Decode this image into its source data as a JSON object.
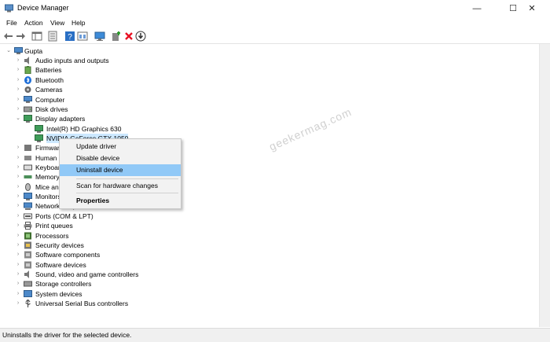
{
  "window": {
    "title": "Device Manager",
    "minimize": "—",
    "maximize": "☐",
    "close": "✕"
  },
  "menu": [
    "File",
    "Action",
    "View",
    "Help"
  ],
  "tree": {
    "root": "Gupta",
    "categories": [
      "Audio inputs and outputs",
      "Batteries",
      "Bluetooth",
      "Cameras",
      "Computer",
      "Disk drives",
      "Display adapters"
    ],
    "display_children": [
      "Intel(R) HD Graphics 630",
      "NVIDIA GeForce GTX 1050"
    ],
    "categories_after": [
      "Firmware",
      "Human",
      "Keyboards",
      "Memory",
      "Mice and",
      "Monitors",
      "Network adapters",
      "Ports (COM & LPT)",
      "Print queues",
      "Processors",
      "Security devices",
      "Software components",
      "Software devices",
      "Sound, video and game controllers",
      "Storage controllers",
      "System devices",
      "Universal Serial Bus controllers"
    ]
  },
  "context_menu": {
    "update": "Update driver",
    "disable": "Disable device",
    "uninstall": "Uninstall device",
    "scan": "Scan for hardware changes",
    "properties": "Properties"
  },
  "watermark": "geekermag.com",
  "status": "Uninstalls the driver for the selected device.",
  "colors": {
    "highlight": "#91c9f7",
    "selection": "#cce8ff",
    "delete": "#e81123",
    "accent": "#0078d7"
  }
}
